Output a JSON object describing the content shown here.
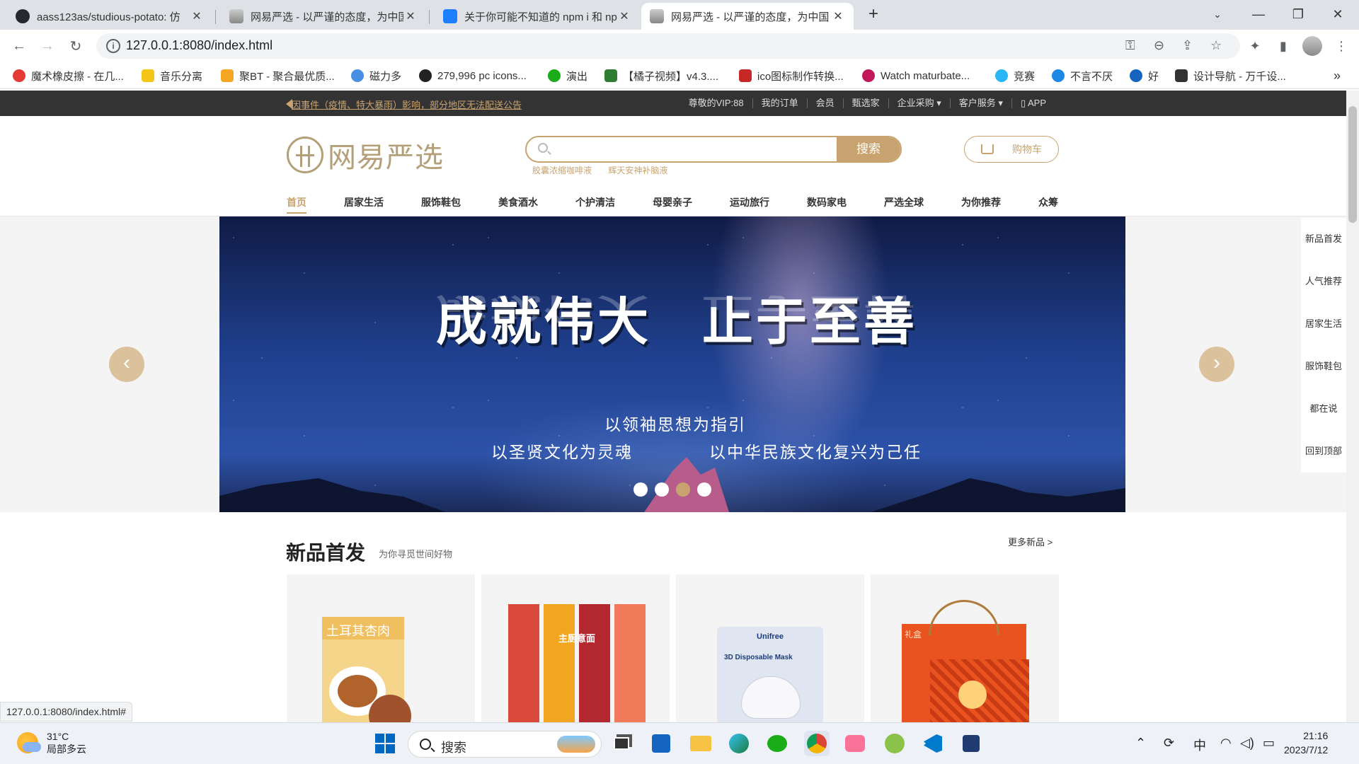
{
  "browser": {
    "tabs": [
      {
        "title": "aass123as/studious-potato: 仿",
        "active": false
      },
      {
        "title": "网易严选 - 以严谨的态度，为中国",
        "active": false
      },
      {
        "title": "关于你可能不知道的 npm i 和 np",
        "active": false
      },
      {
        "title": "网易严选 - 以严谨的态度，为中国",
        "active": true
      }
    ],
    "url": "127.0.0.1:8080/index.html",
    "status_url": "127.0.0.1:8080/index.html#",
    "bookmarks": [
      {
        "label": "魔术橡皮擦 - 在几...",
        "color": "#e53935"
      },
      {
        "label": "音乐分离",
        "color": "#f5c518"
      },
      {
        "label": "聚BT - 聚合最优质...",
        "color": "#f5a623"
      },
      {
        "label": "磁力多",
        "color": "#4a90e2"
      },
      {
        "label": "279,996 pc icons...",
        "color": "#222222"
      },
      {
        "label": "演出",
        "color": "#1aad19"
      },
      {
        "label": "【橘子视频】v4.3....",
        "color": "#2e7d32"
      },
      {
        "label": "ico图标制作转换...",
        "color": "#c62828"
      },
      {
        "label": "Watch maturbate...",
        "color": "#c2185b"
      },
      {
        "label": "竞赛",
        "color": "#29b6f6"
      },
      {
        "label": "不言不厌",
        "color": "#1e88e5"
      },
      {
        "label": "好",
        "color": "#1565c0"
      },
      {
        "label": "设计导航 - 万千设...",
        "color": "#333333"
      }
    ]
  },
  "site": {
    "notice": "因事件（疫情、特大暴雨）影响，部分地区无法配送公告",
    "top_links": [
      "尊敬的VIP:88",
      "我的订单",
      "会员",
      "甄选家",
      "企业采购 ▾",
      "客户服务 ▾",
      "▯ APP"
    ],
    "logo_text": "网易严选",
    "search_button": "搜索",
    "search_placeholder": "",
    "hot_words": [
      "胶囊浓缩咖啡液",
      "辉天安神补脑液"
    ],
    "cart_label": "购物车",
    "categories": [
      "首页",
      "居家生活",
      "服饰鞋包",
      "美食酒水",
      "个护清洁",
      "母婴亲子",
      "运动旅行",
      "数码家电",
      "严选全球",
      "为你推荐",
      "众筹"
    ],
    "active_category": "首页",
    "banner": {
      "headline_left": "成就伟大",
      "headline_right": "止于至善",
      "line1": "以领袖思想为指引",
      "line2_left": "以圣贤文化为灵魂",
      "line2_right": "以中华民族文化复兴为己任",
      "dots": 4,
      "active_dot": 3
    },
    "side_nav": [
      "新品首发",
      "人气推荐",
      "居家生活",
      "服饰鞋包",
      "都在说",
      "回到顶部"
    ],
    "section": {
      "title": "新品首发",
      "subtitle": "为你寻觅世间好物",
      "more": "更多新品 >"
    },
    "products": [
      {
        "label": "土耳其杏肉"
      },
      {
        "label": "主厨意面"
      },
      {
        "label": "3D Disposable Mask"
      },
      {
        "label": "礼盒"
      }
    ]
  },
  "taskbar": {
    "temp": "31°C",
    "weather": "局部多云",
    "search": "搜索",
    "ime": "中",
    "time": "21:16",
    "date": "2023/7/12"
  }
}
